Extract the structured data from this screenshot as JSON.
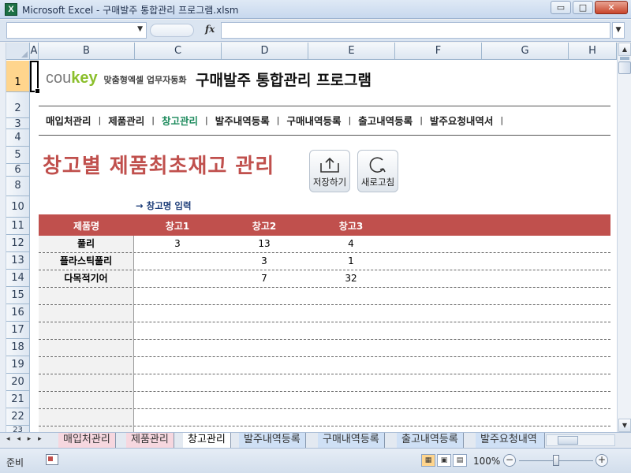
{
  "window": {
    "title": "Microsoft Excel - 구매발주 통합관리 프로그램.xlsm",
    "app_icon": "X",
    "minimize": "▭",
    "maximize": "□",
    "close": "✕"
  },
  "formula_bar": {
    "name_box_value": "",
    "fx_label": "fx",
    "formula_value": ""
  },
  "columns": [
    "A",
    "B",
    "C",
    "D",
    "E",
    "F",
    "G",
    "H"
  ],
  "rows": [
    "1",
    "2",
    "3",
    "4",
    "5",
    "6",
    "8",
    "10",
    "11",
    "12",
    "13",
    "14",
    "15",
    "16",
    "17",
    "18",
    "19",
    "20",
    "21",
    "22",
    "23"
  ],
  "branding": {
    "logo_cou": "cou",
    "logo_key": "key",
    "logo_tagline": "맞춤형엑셀 업무자동화",
    "app_title": "구매발주 통합관리 프로그램"
  },
  "nav": {
    "items": [
      {
        "label": "매입처관리"
      },
      {
        "label": "제품관리"
      },
      {
        "label": "창고관리"
      },
      {
        "label": "발주내역등록"
      },
      {
        "label": "구매내역등록"
      },
      {
        "label": "출고내역등록"
      },
      {
        "label": "발주요청내역서"
      }
    ],
    "separator": "|",
    "active_index": 2
  },
  "page": {
    "heading": "창고별 제품최초재고 관리",
    "save_button": "저장하기",
    "refresh_button": "새로고침",
    "hint": "→ 창고명 입력"
  },
  "table": {
    "headers": [
      "제품명",
      "창고1",
      "창고2",
      "창고3"
    ],
    "rows": [
      {
        "name": "풀리",
        "w1": "3",
        "w2": "13",
        "w3": "4"
      },
      {
        "name": "플라스틱풀리",
        "w1": "",
        "w2": "3",
        "w3": "1"
      },
      {
        "name": "다목적기어",
        "w1": "",
        "w2": "7",
        "w3": "32"
      }
    ]
  },
  "sheet_tabs": {
    "nav_glyphs": "◂ ◂ ▸ ▸",
    "tabs": [
      {
        "label": "매입처관리",
        "style": "pink"
      },
      {
        "label": "제품관리",
        "style": "pink"
      },
      {
        "label": "창고관리",
        "style": "active"
      },
      {
        "label": "발주내역등록",
        "style": "blue"
      },
      {
        "label": "구매내역등록",
        "style": "blue"
      },
      {
        "label": "출고내역등록",
        "style": "blue"
      },
      {
        "label": "발주요청내역",
        "style": "blue"
      }
    ]
  },
  "status": {
    "mode": "준비",
    "zoom": "100%",
    "zoom_minus": "−",
    "zoom_plus": "+"
  },
  "colors": {
    "accent_red": "#c0504d",
    "active_nav": "#1c8a5c",
    "logo_green": "#8bbf2c"
  }
}
